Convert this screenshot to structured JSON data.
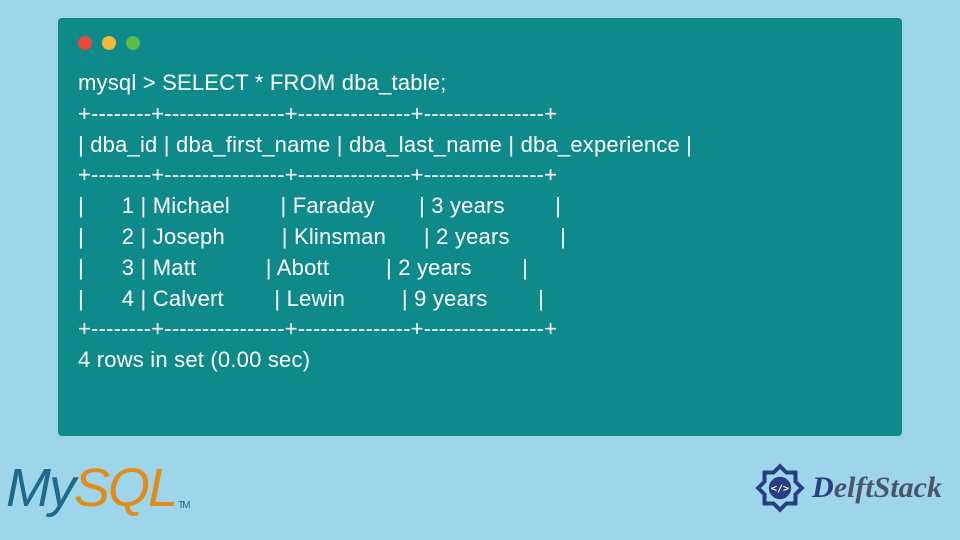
{
  "terminal": {
    "prompt": "mysql > SELECT * FROM dba_table;",
    "border_top": "+--------+----------------+---------------+----------------+",
    "header_row": "| dba_id | dba_first_name | dba_last_name | dba_experience |",
    "border_mid": "+--------+----------------+---------------+----------------+",
    "row1": "|      1 | Michael        | Faraday       | 3 years        |",
    "row2": "|      2 | Joseph         | Klinsman      | 2 years        |",
    "row3": "|      3 | Matt           | Abott         | 2 years        |",
    "row4": "|      4 | Calvert        | Lewin         | 9 years        |",
    "border_bot": "+--------+----------------+---------------+----------------+",
    "status": "4 rows in set (0.00 sec)"
  },
  "chart_data": {
    "type": "table",
    "query": "SELECT * FROM dba_table;",
    "columns": [
      "dba_id",
      "dba_first_name",
      "dba_last_name",
      "dba_experience"
    ],
    "rows": [
      {
        "dba_id": 1,
        "dba_first_name": "Michael",
        "dba_last_name": "Faraday",
        "dba_experience": "3 years"
      },
      {
        "dba_id": 2,
        "dba_first_name": "Joseph",
        "dba_last_name": "Klinsman",
        "dba_experience": "2 years"
      },
      {
        "dba_id": 3,
        "dba_first_name": "Matt",
        "dba_last_name": "Abott",
        "dba_experience": "2 years"
      },
      {
        "dba_id": 4,
        "dba_first_name": "Calvert",
        "dba_last_name": "Lewin",
        "dba_experience": "9 years"
      }
    ],
    "row_count": 4,
    "elapsed_sec": 0.0
  },
  "logos": {
    "mysql_my": "My",
    "mysql_sql": "SQL",
    "mysql_tm": "TM",
    "delft_d": "D",
    "delft_rest": "elftStack"
  }
}
